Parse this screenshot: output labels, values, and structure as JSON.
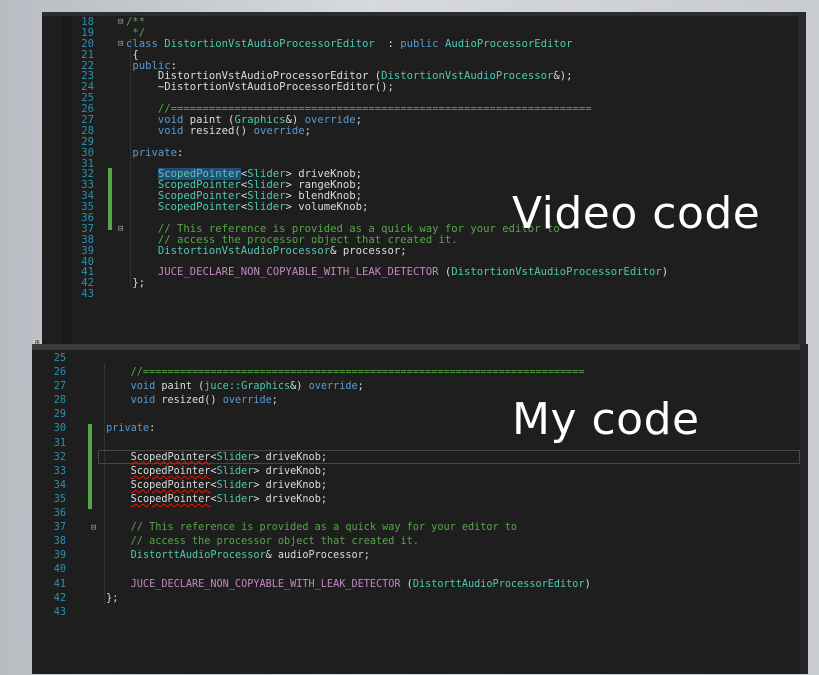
{
  "video": {
    "label": "Video code",
    "lines": [
      {
        "n": "18",
        "fold": "⊟",
        "parts": [
          [
            "cm",
            "/**"
          ]
        ]
      },
      {
        "n": "19",
        "parts": [
          [
            "cm",
            " */"
          ]
        ]
      },
      {
        "n": "20",
        "fold": "⊟",
        "parts": [
          [
            "kw",
            "class "
          ],
          [
            "ty",
            "DistortionVstAudioProcessorEditor"
          ],
          [
            "pl",
            "  : "
          ],
          [
            "kw",
            "public "
          ],
          [
            "ty",
            "AudioProcessorEditor"
          ]
        ]
      },
      {
        "n": "21",
        "parts": [
          [
            "pl",
            " {"
          ]
        ]
      },
      {
        "n": "22",
        "parts": [
          [
            "kw",
            " public"
          ],
          [
            "pl",
            ":"
          ]
        ]
      },
      {
        "n": "23",
        "parts": [
          [
            "pl",
            "     DistortionVstAudioProcessorEditor ("
          ],
          [
            "ty",
            "DistortionVstAudioProcessor"
          ],
          [
            "pl",
            "&);"
          ]
        ]
      },
      {
        "n": "24",
        "parts": [
          [
            "pl",
            "     ~DistortionVstAudioProcessorEditor();"
          ]
        ]
      },
      {
        "n": "25",
        "parts": [
          [
            "pl",
            ""
          ]
        ]
      },
      {
        "n": "26",
        "parts": [
          [
            "cm",
            "     //=================================================================="
          ]
        ]
      },
      {
        "n": "27",
        "parts": [
          [
            "kw",
            "     void "
          ],
          [
            "pl",
            "paint ("
          ],
          [
            "ty",
            "Graphics"
          ],
          [
            "pl",
            "&) "
          ],
          [
            "kw",
            "override"
          ],
          [
            "pl",
            ";"
          ]
        ]
      },
      {
        "n": "28",
        "parts": [
          [
            "kw",
            "     void "
          ],
          [
            "pl",
            "resized() "
          ],
          [
            "kw",
            "override"
          ],
          [
            "pl",
            ";"
          ]
        ]
      },
      {
        "n": "29",
        "parts": [
          [
            "pl",
            ""
          ]
        ]
      },
      {
        "n": "30",
        "parts": [
          [
            "kw",
            " private"
          ],
          [
            "pl",
            ":"
          ]
        ]
      },
      {
        "n": "31",
        "parts": [
          [
            "pl",
            ""
          ]
        ]
      },
      {
        "n": "32",
        "parts": [
          [
            "pl",
            "     "
          ],
          [
            "ty sel",
            "ScopedPointer"
          ],
          [
            "pl",
            "<"
          ],
          [
            "ty",
            "Slider"
          ],
          [
            "pl",
            "> driveKnob;"
          ]
        ]
      },
      {
        "n": "33",
        "parts": [
          [
            "pl",
            "     "
          ],
          [
            "ty",
            "ScopedPointer"
          ],
          [
            "pl",
            "<"
          ],
          [
            "ty",
            "Slider"
          ],
          [
            "pl",
            "> rangeKnob;"
          ]
        ]
      },
      {
        "n": "34",
        "parts": [
          [
            "pl",
            "     "
          ],
          [
            "ty",
            "ScopedPointer"
          ],
          [
            "pl",
            "<"
          ],
          [
            "ty",
            "Slider"
          ],
          [
            "pl",
            "> blendKnob;"
          ]
        ]
      },
      {
        "n": "35",
        "parts": [
          [
            "pl",
            "     "
          ],
          [
            "ty",
            "ScopedPointer"
          ],
          [
            "pl",
            "<"
          ],
          [
            "ty",
            "Slider"
          ],
          [
            "pl",
            "> volumeKnob;"
          ]
        ]
      },
      {
        "n": "36",
        "parts": [
          [
            "pl",
            ""
          ]
        ]
      },
      {
        "n": "37",
        "fold": "⊟",
        "parts": [
          [
            "cm",
            "     // This reference is provided as a quick way for your editor to"
          ]
        ]
      },
      {
        "n": "38",
        "parts": [
          [
            "cm",
            "     // access the processor object that created it."
          ]
        ]
      },
      {
        "n": "39",
        "parts": [
          [
            "pl",
            "     "
          ],
          [
            "ty",
            "DistortionVstAudioProcessor"
          ],
          [
            "pl",
            "& processor;"
          ]
        ]
      },
      {
        "n": "40",
        "parts": [
          [
            "pl",
            ""
          ]
        ]
      },
      {
        "n": "41",
        "parts": [
          [
            "mc",
            "     JUCE_DECLARE_NON_COPYABLE_WITH_LEAK_DETECTOR"
          ],
          [
            "pl",
            " ("
          ],
          [
            "ty",
            "DistortionVstAudioProcessorEditor"
          ],
          [
            "pl",
            ")"
          ]
        ]
      },
      {
        "n": "42",
        "parts": [
          [
            "pl",
            " };"
          ]
        ]
      },
      {
        "n": "43",
        "parts": [
          [
            "pl",
            ""
          ]
        ]
      }
    ]
  },
  "mine": {
    "label": "My code",
    "lines": [
      {
        "n": "25",
        "parts": [
          [
            "pl",
            ""
          ]
        ]
      },
      {
        "n": "26",
        "parts": [
          [
            "cm",
            "     //========================================================================"
          ]
        ]
      },
      {
        "n": "27",
        "parts": [
          [
            "kw",
            "     void "
          ],
          [
            "fn",
            "paint ("
          ],
          [
            "ty",
            "juce::Graphics"
          ],
          [
            "pl",
            "&) "
          ],
          [
            "kw",
            "override"
          ],
          [
            "pl",
            ";"
          ]
        ]
      },
      {
        "n": "28",
        "parts": [
          [
            "kw",
            "     void "
          ],
          [
            "fn",
            "resized() "
          ],
          [
            "kw",
            "override"
          ],
          [
            "pl",
            ";"
          ]
        ]
      },
      {
        "n": "29",
        "parts": [
          [
            "pl",
            ""
          ]
        ]
      },
      {
        "n": "30",
        "parts": [
          [
            "kw",
            " private"
          ],
          [
            "pl",
            ":"
          ]
        ]
      },
      {
        "n": "31",
        "parts": [
          [
            "pl",
            ""
          ]
        ]
      },
      {
        "n": "32",
        "parts": [
          [
            "pl",
            "     "
          ],
          [
            "pl squig",
            "ScopedPointer"
          ],
          [
            "pl",
            "<"
          ],
          [
            "ty",
            "Slider"
          ],
          [
            "pl",
            "> driveKnob;"
          ]
        ]
      },
      {
        "n": "33",
        "parts": [
          [
            "pl",
            "     "
          ],
          [
            "pl squig",
            "ScopedPointer"
          ],
          [
            "pl",
            "<"
          ],
          [
            "ty",
            "Slider"
          ],
          [
            "pl",
            "> driveKnob;"
          ]
        ]
      },
      {
        "n": "34",
        "parts": [
          [
            "pl",
            "     "
          ],
          [
            "pl squig",
            "ScopedPointer"
          ],
          [
            "pl",
            "<"
          ],
          [
            "ty",
            "Slider"
          ],
          [
            "pl",
            "> driveKnob;"
          ]
        ]
      },
      {
        "n": "35",
        "parts": [
          [
            "pl",
            "     "
          ],
          [
            "pl squig",
            "ScopedPointer"
          ],
          [
            "pl",
            "<"
          ],
          [
            "ty",
            "Slider"
          ],
          [
            "pl",
            "> driveKnob;"
          ]
        ]
      },
      {
        "n": "36",
        "parts": [
          [
            "pl",
            ""
          ]
        ]
      },
      {
        "n": "37",
        "fold": "⊟",
        "parts": [
          [
            "cm",
            "     // This reference is provided as a quick way for your editor to"
          ]
        ]
      },
      {
        "n": "38",
        "parts": [
          [
            "cm",
            "     // access the processor object that created it."
          ]
        ]
      },
      {
        "n": "39",
        "parts": [
          [
            "pl",
            "     "
          ],
          [
            "ty",
            "DistorttAudioProcessor"
          ],
          [
            "pl",
            "& audioProcessor;"
          ]
        ]
      },
      {
        "n": "40",
        "parts": [
          [
            "pl",
            ""
          ]
        ]
      },
      {
        "n": "41",
        "parts": [
          [
            "mc",
            "     JUCE_DECLARE_NON_COPYABLE_WITH_LEAK_DETECTOR"
          ],
          [
            "pl",
            " ("
          ],
          [
            "ty",
            "DistorttAudioProcessorEditor"
          ],
          [
            "pl",
            ")"
          ]
        ]
      },
      {
        "n": "42",
        "parts": [
          [
            "pl",
            " };"
          ]
        ]
      },
      {
        "n": "43",
        "parts": [
          [
            "pl",
            ""
          ]
        ]
      }
    ]
  },
  "colors": {
    "editor_bg": "#1e1e1e",
    "keyword": "#569cd6",
    "type": "#4ec9b0",
    "comment": "#57a64a",
    "macro": "#c586c0",
    "line_number": "#2b91af",
    "selection": "#264f78"
  }
}
